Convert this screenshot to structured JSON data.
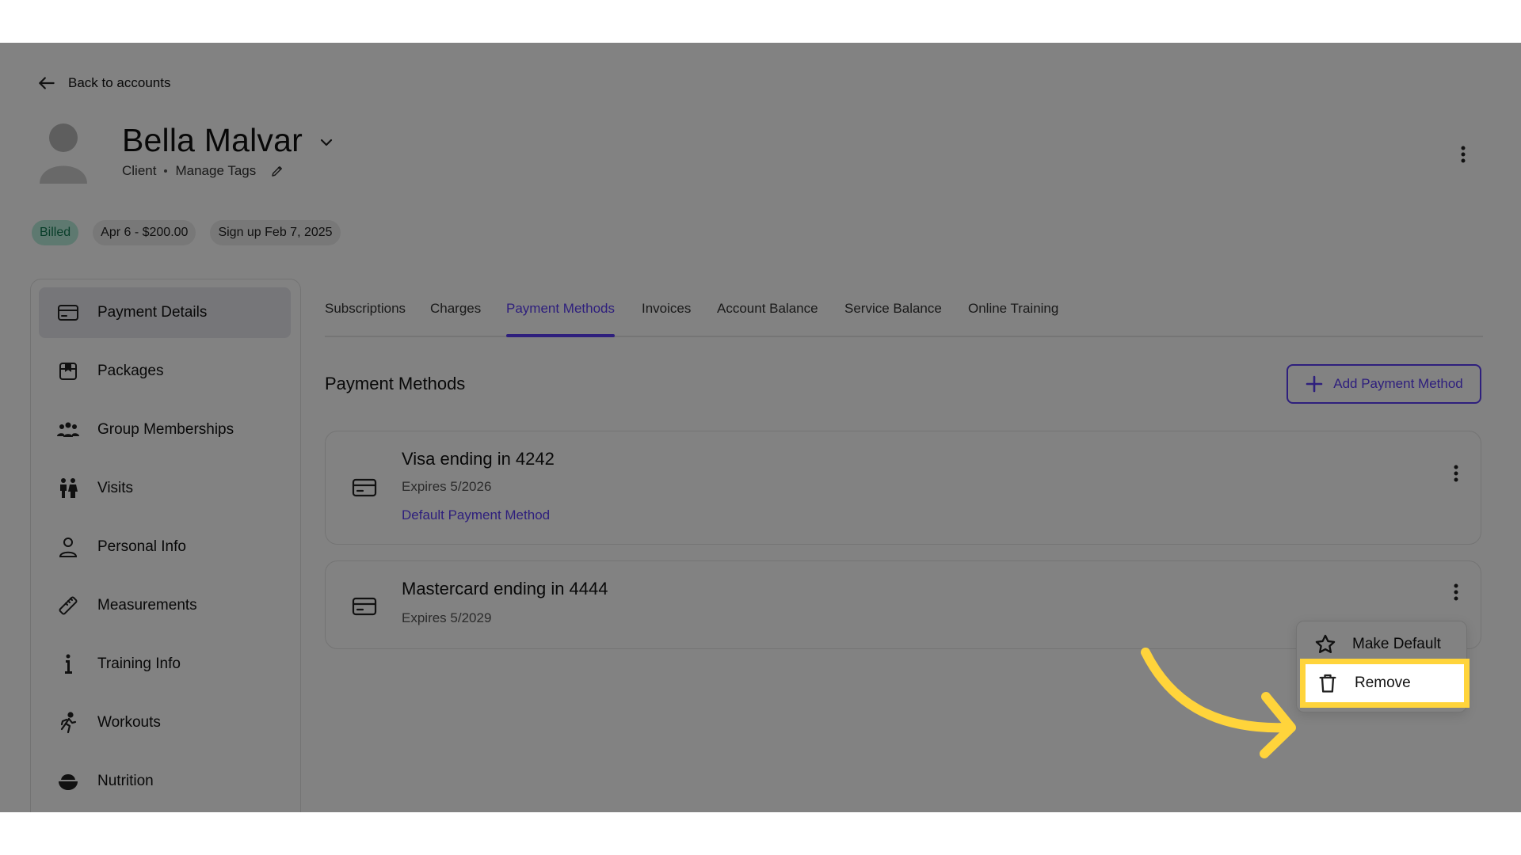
{
  "header": {
    "back_label": "Back to accounts",
    "client_name": "Bella Malvar",
    "role": "Client",
    "manage_tags": "Manage Tags"
  },
  "badges": [
    "Billed",
    "Apr 6 - $200.00",
    "Sign up Feb 7, 2025"
  ],
  "sidebar": {
    "items": [
      {
        "label": "Payment Details",
        "icon": "credit-card-icon"
      },
      {
        "label": "Packages",
        "icon": "package-icon"
      },
      {
        "label": "Group Memberships",
        "icon": "group-icon"
      },
      {
        "label": "Visits",
        "icon": "visits-icon"
      },
      {
        "label": "Personal Info",
        "icon": "person-icon"
      },
      {
        "label": "Measurements",
        "icon": "ruler-icon"
      },
      {
        "label": "Training Info",
        "icon": "info-icon"
      },
      {
        "label": "Workouts",
        "icon": "running-icon"
      },
      {
        "label": "Nutrition",
        "icon": "bowl-icon"
      }
    ]
  },
  "tabs": [
    "Subscriptions",
    "Charges",
    "Payment Methods",
    "Invoices",
    "Account Balance",
    "Service Balance",
    "Online Training"
  ],
  "active_tab": "Payment Methods",
  "payment_methods": {
    "title": "Payment Methods",
    "add_label": "Add Payment Method",
    "cards": [
      {
        "title": "Visa ending in 4242",
        "expires": "Expires 5/2026",
        "default_label": "Default Payment Method"
      },
      {
        "title": "Mastercard ending in 4444",
        "expires": "Expires 5/2029"
      }
    ]
  },
  "context_menu": {
    "make_default": "Make Default",
    "remove": "Remove"
  },
  "colors": {
    "accent": "#5b3df5",
    "highlight": "#ffd43b",
    "billed_bg": "#b9eedc",
    "billed_text": "#137a54"
  }
}
